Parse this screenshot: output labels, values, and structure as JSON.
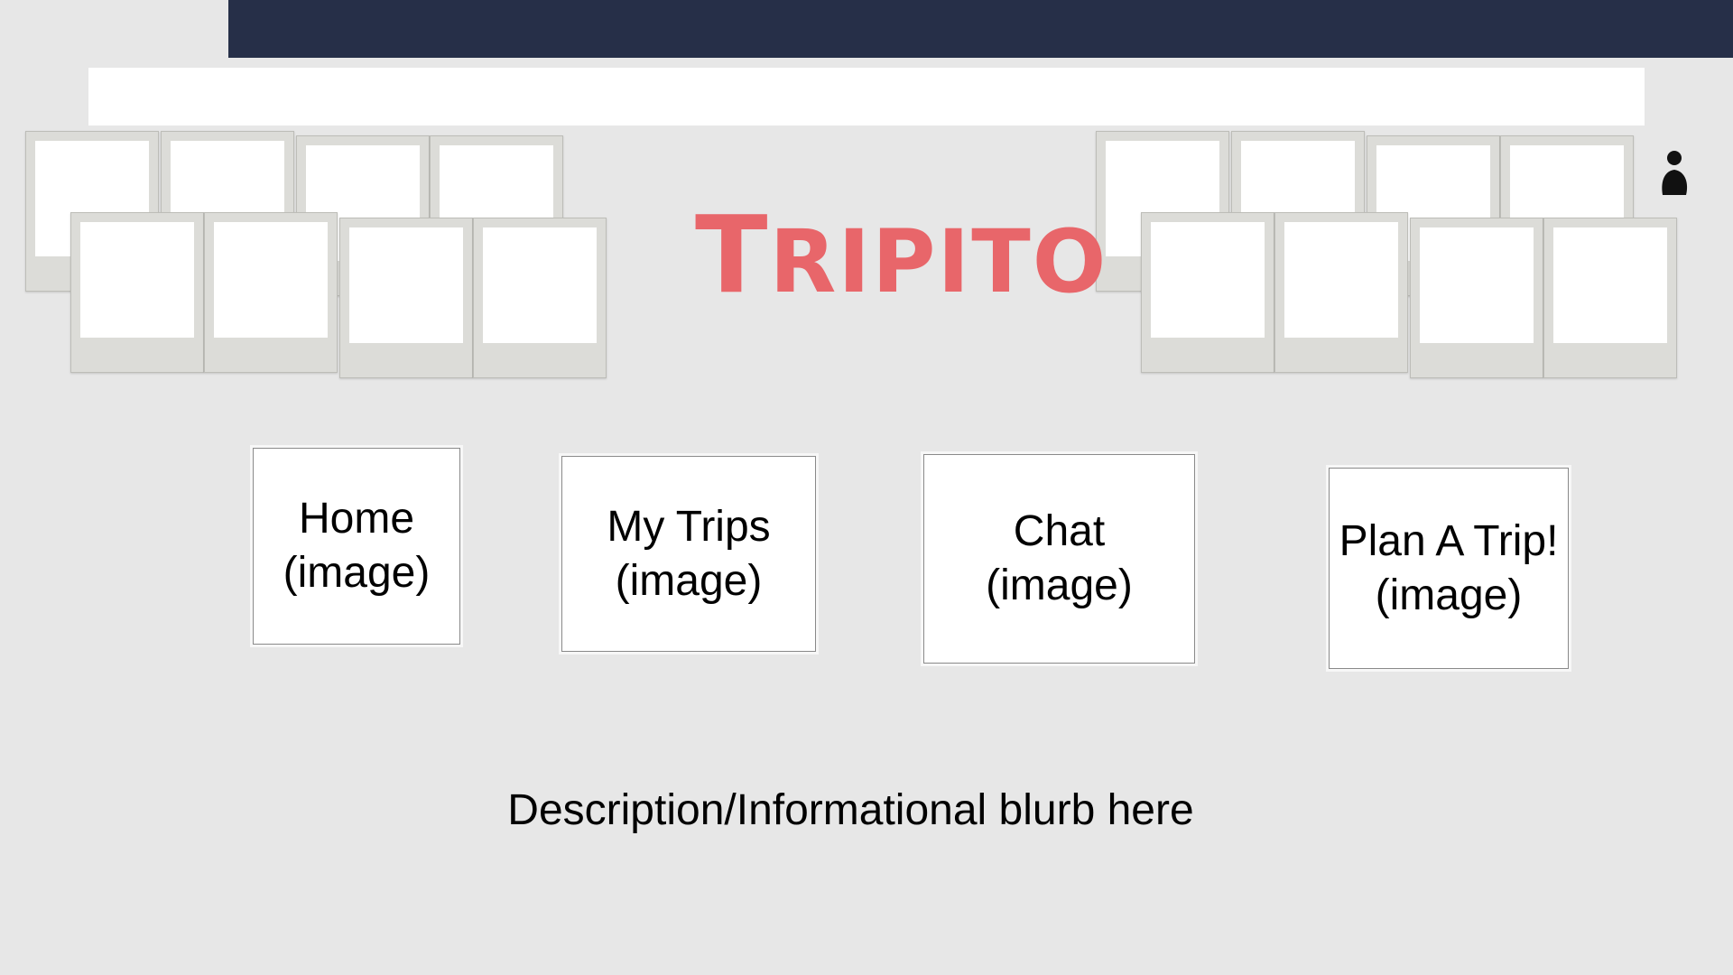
{
  "app": {
    "logo_text": "Tripito",
    "logo_color": "#e8666a",
    "header_color": "#262f48",
    "background_color": "#e7e7e7"
  },
  "search": {
    "value": "",
    "placeholder": ""
  },
  "profile": {
    "icon": "user-silhouette-icon"
  },
  "nav_tiles": [
    {
      "label": "Home",
      "sublabel": "(image)"
    },
    {
      "label": "My Trips",
      "sublabel": "(image)"
    },
    {
      "label": "Chat",
      "sublabel": "(image)"
    },
    {
      "label": "Plan A Trip!",
      "sublabel": "(image)"
    }
  ],
  "blurb": "Description/Informational blurb here"
}
